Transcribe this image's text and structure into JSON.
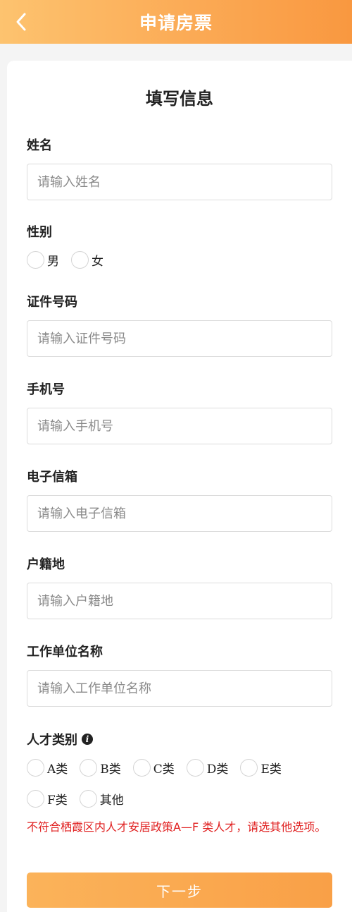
{
  "header": {
    "title": "申请房票",
    "back_icon": "chevron-left-icon"
  },
  "form": {
    "title": "填写信息",
    "name": {
      "label": "姓名",
      "placeholder": "请输入姓名"
    },
    "gender": {
      "label": "性别",
      "options": [
        "男",
        "女"
      ]
    },
    "id_number": {
      "label": "证件号码",
      "placeholder": "请输入证件号码"
    },
    "phone": {
      "label": "手机号",
      "placeholder": "请输入手机号"
    },
    "email": {
      "label": "电子信箱",
      "placeholder": "请输入电子信箱"
    },
    "household": {
      "label": "户籍地",
      "placeholder": "请输入户籍地"
    },
    "employer": {
      "label": "工作单位名称",
      "placeholder": "请输入工作单位名称"
    },
    "talent": {
      "label": "人才类别",
      "info_icon": "info-icon",
      "options": [
        "A类",
        "B类",
        "C类",
        "D类",
        "E类",
        "F类",
        "其他"
      ],
      "warning": "不符合栖霞区内人才安居政策A—F 类人才，请选其他选项。"
    },
    "next_label": "下一步"
  },
  "colors": {
    "header_gradient_start": "#fdc36f",
    "header_gradient_end": "#f99840",
    "button": "#f9a047",
    "warning": "#e02020"
  }
}
